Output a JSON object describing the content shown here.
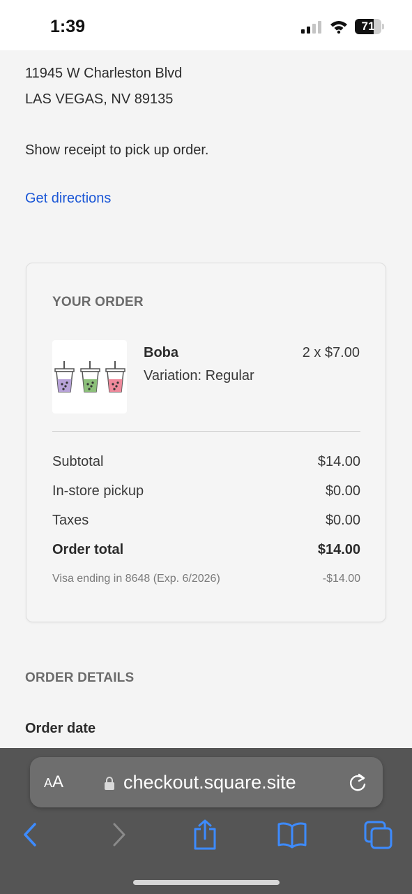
{
  "status_bar": {
    "time": "1:39",
    "battery_level": "71",
    "icons": [
      "signal-icon",
      "wifi-icon",
      "battery-icon"
    ]
  },
  "pickup": {
    "address_line1": "11945 W Charleston Blvd",
    "address_line2": "LAS VEGAS, NV 89135",
    "note": "Show receipt to pick up order.",
    "directions_label": "Get directions"
  },
  "order": {
    "heading": "YOUR ORDER",
    "item": {
      "name": "Boba",
      "variation": "Variation: Regular",
      "quantity_price": "2 x $7.00",
      "image": "boba-cups-image"
    },
    "summary": {
      "subtotal_label": "Subtotal",
      "subtotal_value": "$14.00",
      "pickup_label": "In-store pickup",
      "pickup_value": "$0.00",
      "taxes_label": "Taxes",
      "taxes_value": "$0.00",
      "total_label": "Order total",
      "total_value": "$14.00",
      "payment_label": "Visa ending in 8648 (Exp. 6/2026)",
      "payment_value": "-$14.00"
    }
  },
  "details": {
    "heading": "ORDER DETAILS",
    "order_date_label": "Order date"
  },
  "browser": {
    "text_size_small": "A",
    "text_size_large": "A",
    "url": "checkout.square.site",
    "accent_color": "#3d8bff",
    "toolbar": [
      "back-icon",
      "forward-icon",
      "share-icon",
      "bookmarks-icon",
      "tabs-icon"
    ]
  }
}
